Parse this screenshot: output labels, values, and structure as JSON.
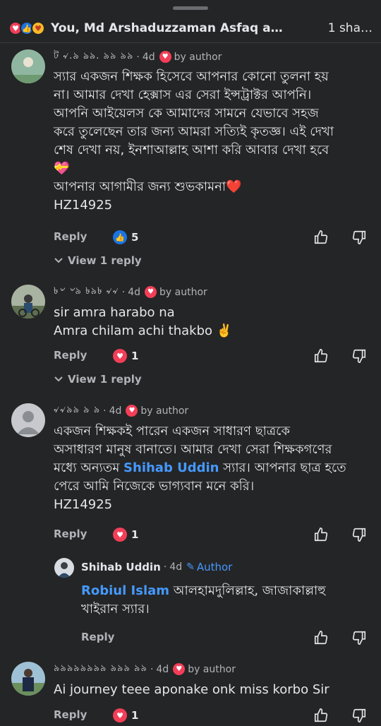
{
  "header": {
    "reactors": "You, Md Arshaduzzaman Asfaq and oth…",
    "shares": "1 sha…"
  },
  "comments": [
    {
      "name": "ট ৵.৯ ঌ৯. ৯৯ ৯৯",
      "time": "4d",
      "badge": "by author",
      "lines": [
        "স্যার একজন শিক্ষক হিসেবে আপনার কোনো তুলনা হয়",
        "না। আমার দেখা হেক্সাস এর সেরা ইন্সট্রাক্টর আপনি।",
        "আপনি আইয়েলস কে আমাদের সামনে যেভাবে সহজ",
        "করে তুলেছেন তার জন্য আমরা সত্যিই কৃতজ্ঞ। এই দেখা",
        "শেষ দেখা নয়, ইনশাআল্লাহ আশা করি আবার দেখা হবে",
        "💝",
        "আপনার আগামীর জন্য শুভকামনা❤️",
        "HZ14925"
      ],
      "reply_label": "Reply",
      "reaction_count": "5",
      "view_replies": "View 1 reply"
    },
    {
      "name": "৳৺ ৺৯ ৳৯৳ ৵৵",
      "time": "4d",
      "badge": "by author",
      "lines": [
        "sir amra harabo na",
        "Amra chilam achi thakbo ✌️"
      ],
      "reply_label": "Reply",
      "reaction_count": "1",
      "view_replies": "View 1 reply"
    },
    {
      "name": "৵৵৯৯ ৯ ৯",
      "time": "4d",
      "badge": "by author",
      "line1": "একজন শিক্ষকই পারেন একজন সাধারণ ছাত্রকে",
      "line2": "অসাধারণ মানুষ বানাতে। আমার দেখা সেরা শিক্ষকগণের",
      "line3_pre": "মধ্যে অন্যতম ",
      "line3_mention": "Shihab Uddin",
      "line3_post": " স্যার। আপনার ছাত্র হতে",
      "line4": "পেরে আমি নিজেকে ভাগ্যবান মনে করি।",
      "line5": "HZ14925",
      "reply_label": "Reply",
      "reaction_count": "1"
    },
    {
      "name": "৯৯৯৯৯৯৯৯ ৯৯৯ ৯৯",
      "time": "4d",
      "badge": "by author",
      "lines": [
        "Ai journey teee aponake onk miss korbo Sir"
      ],
      "reply_label": "Reply",
      "reaction_count": "1"
    }
  ],
  "reply": {
    "name": "Shihab Uddin",
    "time": "4d",
    "badge": "Author",
    "mention": "Robiul Islam",
    "line1_post": " আলহামদুলিল্লাহ, জাজাকাল্লাহু",
    "line2": "খাইরান স্যার।",
    "reply_label": "Reply"
  },
  "colors": {
    "accent": "#4599ff",
    "love": "#f33e58",
    "like": "#1b74e4",
    "bg": "#242526"
  }
}
